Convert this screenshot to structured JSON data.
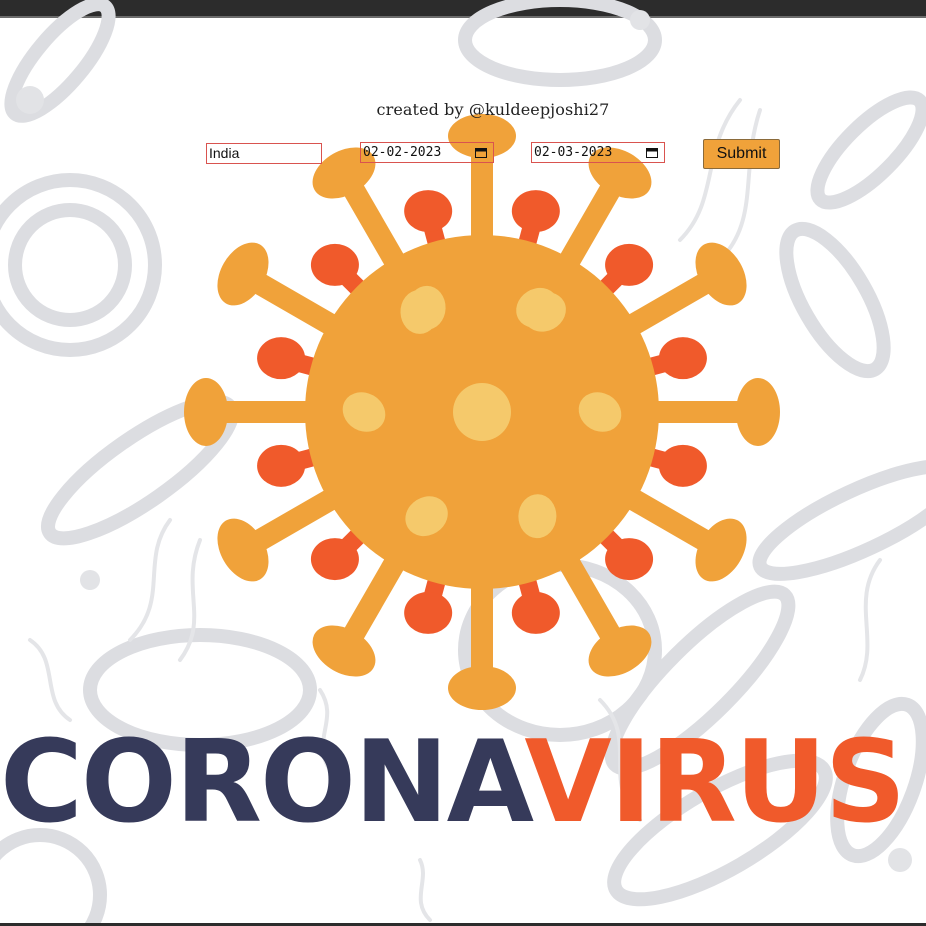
{
  "credit_text": "created by @kuldeepjoshi27",
  "form": {
    "country_value": "India",
    "from_date": "02-02-2023",
    "to_date": "02-03-2023",
    "submit_label": "Submit"
  },
  "title": {
    "part1": "CORONA",
    "part2": "VIRUS"
  },
  "colors": {
    "title_dark": "#363a5a",
    "title_accent": "#f05a2b",
    "virus_body": "#f0a23a",
    "virus_spike_red": "#f05a2b",
    "virus_spot": "#f5c96b",
    "button": "#f0a23a",
    "background_pattern": "#dcdde1"
  },
  "icons": {
    "date_picker": "calendar-icon",
    "illustration": "coronavirus-icon"
  }
}
